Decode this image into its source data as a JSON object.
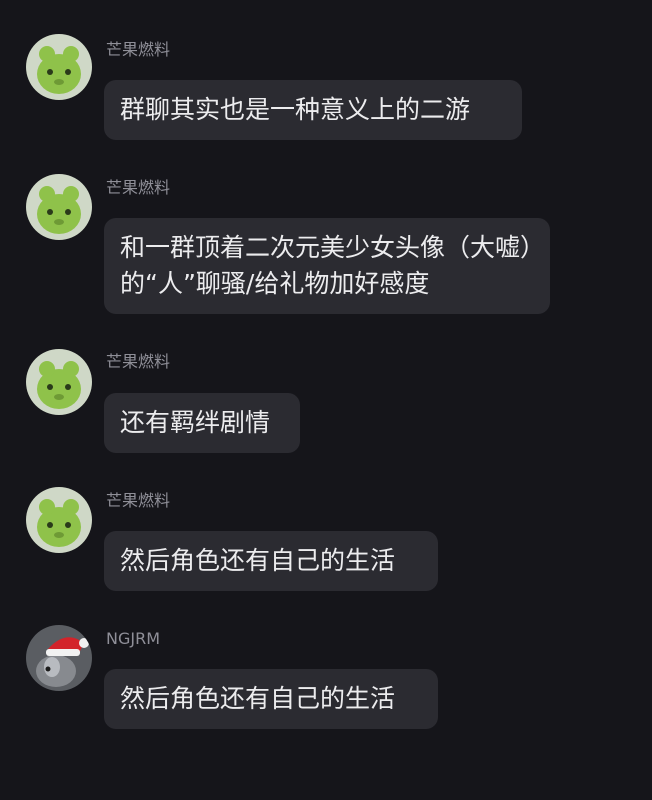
{
  "messages": [
    {
      "sender": "芒果燃料",
      "text": "群聊其实也是一种意义上的二游",
      "avatar": "green-fuzzy-creature-icon"
    },
    {
      "sender": "芒果燃料",
      "text": "和一群顶着二次元美少女头像（大嘘）的“人”聊骚/给礼物加好感度",
      "avatar": "green-fuzzy-creature-icon"
    },
    {
      "sender": "芒果燃料",
      "text": "还有羁绊剧情",
      "avatar": "green-fuzzy-creature-icon"
    },
    {
      "sender": "芒果燃料",
      "text": "然后角色还有自己的生活",
      "avatar": "green-fuzzy-creature-icon"
    },
    {
      "sender": "NGJRM",
      "text": "然后角色还有自己的生活",
      "avatar": "santa-hat-avatar-icon"
    }
  ],
  "colors": {
    "background": "#15151a",
    "bubble": "#2b2b31",
    "text": "#ececee",
    "sender": "#8f8f98",
    "avatar_green": "#8fc24a",
    "santa_red": "#d3232a"
  }
}
